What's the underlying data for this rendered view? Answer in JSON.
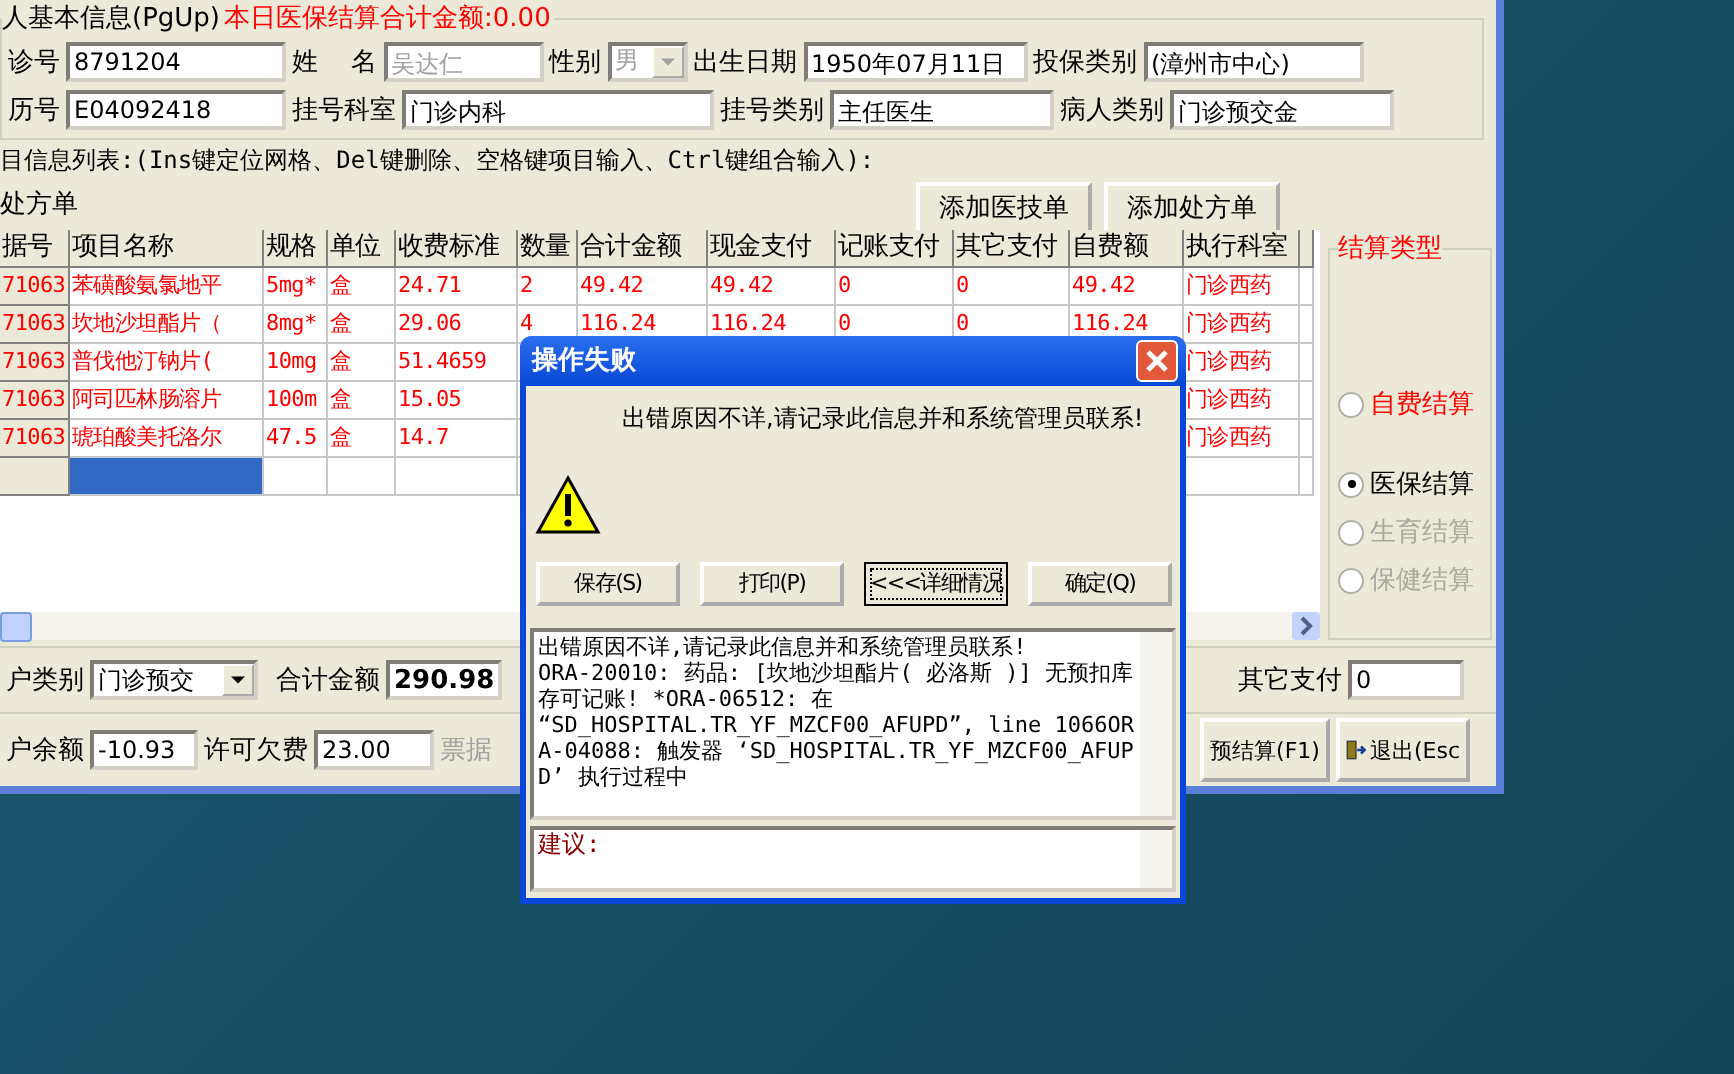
{
  "patient_info": {
    "legend": "人基本信息(PgUp)",
    "daily_total": "本日医保结算合计金额:0.00",
    "row_1": [
      {
        "label": "诊号",
        "value": "8791204",
        "disabled": false,
        "kind": "input"
      },
      {
        "label": "姓    名",
        "value": "吴达仁",
        "disabled": true,
        "kind": "input"
      },
      {
        "label": "性别",
        "value": "男",
        "disabled": true,
        "kind": "select"
      },
      {
        "label": "出生日期",
        "value": "1950年07月11日",
        "disabled": false,
        "kind": "input"
      },
      {
        "label": "投保类别",
        "value": "(漳州市中心)",
        "disabled": false,
        "kind": "input"
      }
    ],
    "row_2": [
      {
        "label": "历号",
        "value": "E04092418",
        "disabled": false,
        "kind": "input"
      },
      {
        "label": "挂号科室",
        "value": "门诊内科",
        "disabled": false,
        "kind": "input"
      },
      {
        "label": "挂号类别",
        "value": "主任医生",
        "disabled": false,
        "kind": "input"
      },
      {
        "label": "病人类别",
        "value": "门诊预交金",
        "disabled": false,
        "kind": "input"
      }
    ]
  },
  "items_hint": "目信息列表:(Ins键定位网格、Del键删除、空格键项目输入、Ctrl键组合输入):",
  "add_buttons": [
    "添加医技单",
    "添加处方单"
  ],
  "prescription_label": "处方单",
  "table": {
    "columns": [
      "据号",
      "项目名称",
      "规格",
      "单位",
      "收费标准",
      "数量",
      "合计金额",
      "现金支付",
      "记账支付",
      "其它支付",
      "自费额",
      "执行科室",
      ""
    ],
    "rows": [
      {
        "cells": [
          "71063",
          "苯磺酸氨氯地平",
          "5mg*",
          "盒",
          "24.71",
          "2",
          "49.42",
          "49.42",
          "0",
          "0",
          "49.42",
          "门诊西药",
          ""
        ]
      },
      {
        "cells": [
          "71063",
          "坎地沙坦酯片（",
          "8mg*",
          "盒",
          "29.06",
          "4",
          "116.24",
          "116.24",
          "0",
          "0",
          "116.24",
          "门诊西药",
          ""
        ]
      },
      {
        "cells": [
          "71063",
          "普伐他汀钠片(",
          "10mg",
          "盒",
          "51.4659",
          null,
          null,
          null,
          null,
          null,
          null,
          "门诊西药",
          ""
        ]
      },
      {
        "cells": [
          "71063",
          "阿司匹林肠溶片",
          "100m",
          "盒",
          "15.05",
          null,
          null,
          null,
          null,
          null,
          null,
          "门诊西药",
          ""
        ]
      },
      {
        "cells": [
          "71063",
          "琥珀酸美托洛尔",
          "47.5",
          "盒",
          "14.7",
          null,
          null,
          null,
          null,
          null,
          null,
          "门诊西药",
          ""
        ]
      }
    ]
  },
  "settlement": {
    "legend": "结算类型",
    "options": [
      {
        "label": "自费结算",
        "selected": false,
        "disabled": false,
        "color": "#ff0000"
      },
      {
        "label": "医保结算",
        "selected": true,
        "disabled": false,
        "color": "#000000"
      },
      {
        "label": "生育结算",
        "selected": false,
        "disabled": true
      },
      {
        "label": "保健结算",
        "selected": false,
        "disabled": true
      }
    ]
  },
  "footer": {
    "account_type_label": "户类别",
    "account_type": "门诊预交",
    "total_label": "合计金额",
    "total": "290.98",
    "other_pay_label": "其它支付",
    "other_pay": "0",
    "balance_label": "户余额",
    "balance": "-10.93",
    "credit_label": "许可欠费",
    "credit": "23.00",
    "receipt_label": "票据",
    "buttons": [
      {
        "label": "预结算(F1)",
        "kind": "plain"
      },
      {
        "label": "退出(Esc",
        "kind": "exit"
      }
    ]
  },
  "dialog": {
    "title": "操作失败",
    "message": "出错原因不详,请记录此信息并和系统管理员联系!",
    "buttons": [
      {
        "label": "保存(S)",
        "focused": false
      },
      {
        "label": "打印(P)",
        "focused": false
      },
      {
        "label": "<<<详细情况",
        "focused": true
      },
      {
        "label": "确定(Q)",
        "focused": false
      }
    ],
    "details": "出错原因不详,请记录此信息并和系统管理员联系!\nORA-20010: 药品: [坎地沙坦酯片( 必洛斯 )] 无预扣库存可记账! *ORA-06512: 在\n“SD_HOSPITAL.TR_YF_MZCF00_AFUPD”, line 1066ORA-04088: 触发器 ‘SD_HOSPITAL.TR_YF_MZCF00_AFUPD’ 执行过程中",
    "suggestion_label": "建议:"
  }
}
